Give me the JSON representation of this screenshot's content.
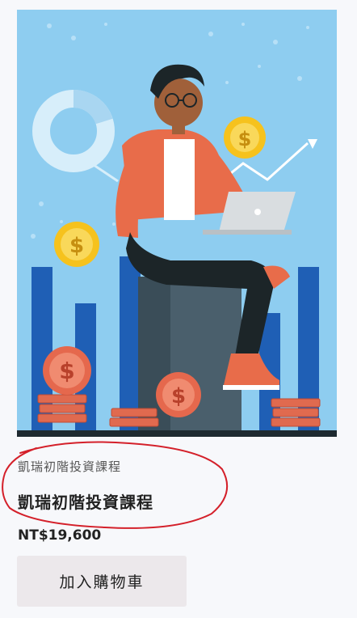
{
  "product": {
    "subtitle": "凱瑞初階投資課程",
    "title": "凱瑞初階投資課程",
    "price": "NT$19,600",
    "add_to_cart_label": "加入購物車"
  },
  "image": {
    "icon": "investor-laptop-illustration",
    "background_color": "#8ecdf0",
    "coin_symbol": "$"
  },
  "annotation": {
    "color": "#d4202a"
  }
}
